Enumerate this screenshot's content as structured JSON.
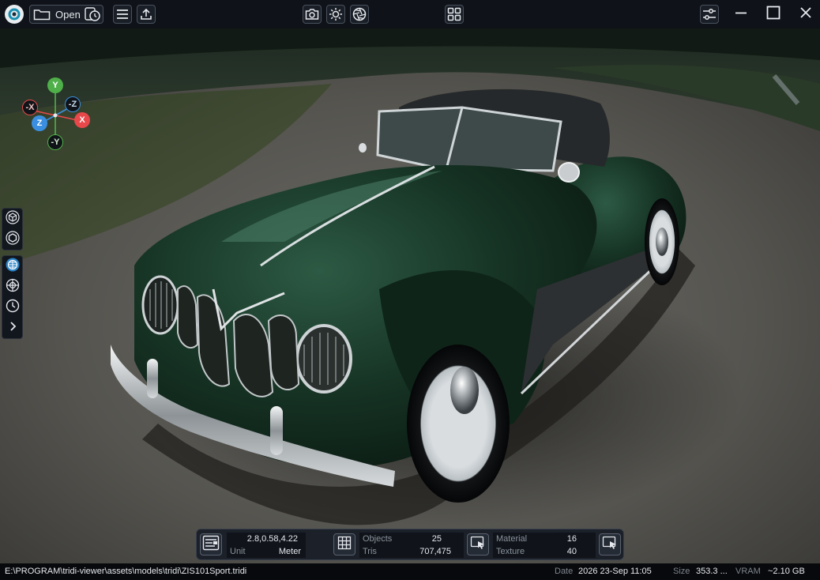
{
  "app": {
    "open_label": "Open"
  },
  "icons": {
    "logo": "app-logo-icon",
    "open": "folder-icon",
    "recent": "history-icon",
    "menu": "hamburger-menu-icon",
    "export": "upload-icon",
    "screenshot": "camera-icon",
    "lighting": "sun-icon",
    "render": "aperture-icon",
    "layout": "grid-layout-icon",
    "settings": "sliders-icon",
    "minimize": "minimize-icon",
    "maximize": "maximize-icon",
    "close": "close-icon"
  },
  "gizmo": {
    "y": "Y",
    "neg_y": "-Y",
    "x": "X",
    "neg_x": "-X",
    "z": "Z",
    "neg_z": "-Z",
    "colors": {
      "x": "#e8484a",
      "y": "#4fb04a",
      "z": "#3b8fe0"
    }
  },
  "info": {
    "position": "2.8,0.58,4.22",
    "unit_label": "Unit",
    "unit_value": "Meter",
    "objects_label": "Objects",
    "objects_value": "25",
    "tris_label": "Tris",
    "tris_value": "707,475",
    "material_label": "Material",
    "material_value": "16",
    "texture_label": "Texture",
    "texture_value": "40"
  },
  "status": {
    "path": "E:\\PROGRAM\\tridi-viewer\\assets\\models\\tridi\\ZIS101Sport.tridi",
    "date_label": "Date",
    "date_value": "2026 23-Sep 11:05",
    "size_label": "Size",
    "size_value": "353.3 ...",
    "vram_label": "VRAM",
    "vram_value": "~2.10 GB"
  },
  "colors": {
    "accent": "#2a83c7",
    "titlebar": "#0f1218",
    "car_body": "#173326"
  }
}
